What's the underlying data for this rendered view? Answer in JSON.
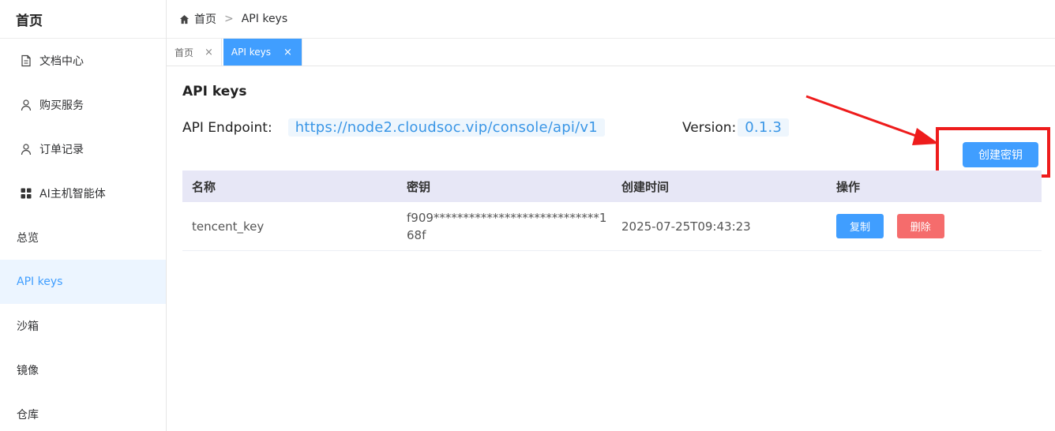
{
  "sidebar": {
    "logo": "首页",
    "items": [
      {
        "label": "文档中心",
        "icon": "document-icon"
      },
      {
        "label": "购买服务",
        "icon": "user-icon"
      },
      {
        "label": "订单记录",
        "icon": "user-icon"
      },
      {
        "label": "AI主机智能体",
        "icon": "grid-icon"
      },
      {
        "label": "总览"
      },
      {
        "label": "API keys",
        "active": true
      },
      {
        "label": "沙箱"
      },
      {
        "label": "镜像"
      },
      {
        "label": "仓库"
      }
    ]
  },
  "header": {
    "breadcrumb_home": "首页",
    "breadcrumb_separator": ">",
    "breadcrumb_current": "API keys"
  },
  "tabs": [
    {
      "label": "首页",
      "close": "×"
    },
    {
      "label": "API keys",
      "close": "×",
      "active": true
    }
  ],
  "main": {
    "title": "API keys",
    "endpoint_label": "API Endpoint:",
    "endpoint_value": "https://node2.cloudsoc.vip/console/api/v1",
    "version_label": "Version:",
    "version_value": "0.1.3",
    "create_button": "创建密钥"
  },
  "table": {
    "headers": [
      "名称",
      "密钥",
      "创建时间",
      "操作"
    ],
    "rows": [
      {
        "name": "tencent_key",
        "secret": "f909****************************168f",
        "created": "2025-07-25T09:43:23",
        "copy": "复制",
        "delete": "删除"
      }
    ]
  },
  "colors": {
    "accent": "#409eff",
    "danger": "#f56c6c",
    "annotation": "#ee1c1c",
    "active_menu_bg": "#ecf5ff",
    "table_header_bg": "#e7e7f6"
  }
}
